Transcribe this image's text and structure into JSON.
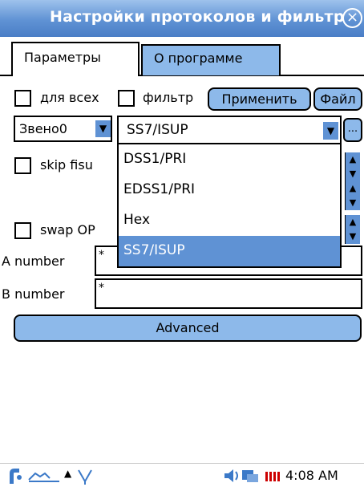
{
  "window": {
    "title": "Настройки протоколов и фильтр"
  },
  "tabs": [
    {
      "label": "Параметры"
    },
    {
      "label": "О программе"
    }
  ],
  "options": {
    "for_all_label": "для всех",
    "filter_label": "фильтр",
    "apply_button": "Применить",
    "file_button": "Файл",
    "skip_fisu_label": "skip fisu",
    "swap_opc_label": "swap OP"
  },
  "link_dropdown": {
    "value": "Звено0"
  },
  "protocol_dropdown": {
    "value": "SS7/ISUP",
    "browse_button": "...",
    "options": [
      "DSS1/PRI",
      "EDSS1/PRI",
      "Hex",
      "SS7/ISUP"
    ],
    "selected_index": 3
  },
  "numbers": {
    "a_label": "A number",
    "a_value": "*",
    "b_label": "B number",
    "b_value": "*"
  },
  "advanced_button": "Advanced",
  "taskbar": {
    "time": "4:08 AM"
  },
  "colors": {
    "accent": "#5f92d4",
    "button_fill": "#8db9ea"
  }
}
